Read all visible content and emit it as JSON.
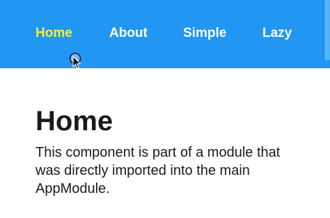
{
  "nav": {
    "items": [
      {
        "label": "Home",
        "active": true
      },
      {
        "label": "About",
        "active": false
      },
      {
        "label": "Simple",
        "active": false
      },
      {
        "label": "Lazy",
        "active": false
      }
    ]
  },
  "main": {
    "title": "Home",
    "description": "This component is part of a module that was directly imported into the main AppModule."
  },
  "colors": {
    "navbar_bg": "#2196f3",
    "nav_link": "#ffffff",
    "nav_link_active": "#ffeb3b",
    "text": "#1a1a1a"
  },
  "icons": {
    "cursor": "pointer-cursor-icon"
  }
}
